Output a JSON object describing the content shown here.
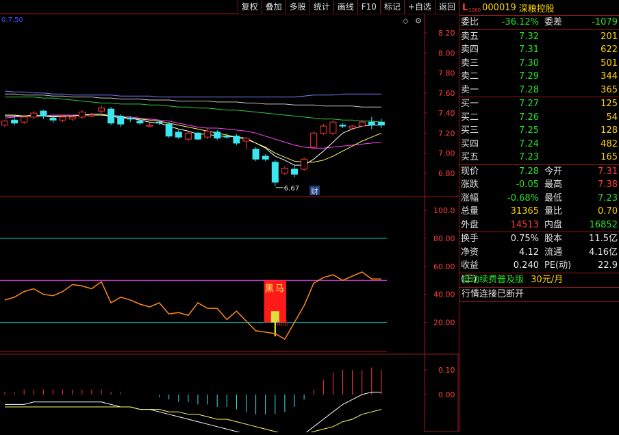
{
  "toolbar": [
    "复权",
    "叠加",
    "多股",
    "统计",
    "画线",
    "F10",
    "标记",
    "+自选",
    "返回"
  ],
  "header": {
    "left_value": "0.7.50",
    "diamond": "◇",
    "settings": "⚙"
  },
  "price_axis": [
    "8.20",
    "8.00",
    "7.80",
    "7.60",
    "7.40",
    "7.20",
    "7.00",
    "6.80"
  ],
  "osc_axis": [
    "100.0",
    "80.00",
    "60.00",
    "40.00",
    "20.00"
  ],
  "macd_axis": [
    "0.10",
    "0.00"
  ],
  "annotations": {
    "low_label": "6.67",
    "cai": "财",
    "hei_ma": "黑马",
    "zhu": "出击"
  },
  "candles": [
    [
      7.28,
      7.32,
      7.33,
      7.26
    ],
    [
      7.33,
      7.3,
      7.36,
      7.28
    ],
    [
      7.31,
      7.36,
      7.38,
      7.29
    ],
    [
      7.36,
      7.4,
      7.42,
      7.34
    ],
    [
      7.42,
      7.37,
      7.43,
      7.34
    ],
    [
      7.35,
      7.33,
      7.37,
      7.3
    ],
    [
      7.33,
      7.36,
      7.38,
      7.31
    ],
    [
      7.34,
      7.36,
      7.38,
      7.32
    ],
    [
      7.36,
      7.41,
      7.43,
      7.34
    ],
    [
      7.38,
      7.38,
      7.4,
      7.36
    ],
    [
      7.42,
      7.45,
      7.48,
      7.4
    ],
    [
      7.44,
      7.3,
      7.46,
      7.28
    ],
    [
      7.37,
      7.29,
      7.39,
      7.26
    ],
    [
      7.35,
      7.34,
      7.37,
      7.31
    ],
    [
      7.32,
      7.3,
      7.34,
      7.28
    ],
    [
      7.28,
      7.28,
      7.3,
      7.26
    ],
    [
      7.31,
      7.3,
      7.32,
      7.28
    ],
    [
      7.29,
      7.17,
      7.31,
      7.15
    ],
    [
      7.21,
      7.16,
      7.23,
      7.14
    ],
    [
      7.14,
      7.2,
      7.22,
      7.12
    ],
    [
      7.2,
      7.14,
      7.21,
      7.13
    ],
    [
      7.16,
      7.22,
      7.25,
      7.14
    ],
    [
      7.21,
      7.15,
      7.23,
      7.13
    ],
    [
      7.17,
      7.16,
      7.2,
      7.14
    ],
    [
      7.17,
      7.1,
      7.19,
      7.08
    ],
    [
      7.12,
      7.15,
      7.16,
      7.04
    ],
    [
      7.04,
      6.94,
      7.06,
      6.92
    ],
    [
      6.97,
      6.94,
      6.99,
      6.92
    ],
    [
      6.91,
      6.71,
      6.93,
      6.67
    ],
    [
      6.8,
      6.85,
      6.87,
      6.78
    ],
    [
      6.84,
      6.79,
      6.88,
      6.76
    ],
    [
      6.84,
      6.94,
      6.96,
      6.82
    ],
    [
      7.06,
      7.2,
      7.22,
      7.04
    ],
    [
      7.2,
      7.27,
      7.29,
      7.18
    ],
    [
      7.2,
      7.31,
      7.33,
      7.18
    ],
    [
      7.28,
      7.27,
      7.3,
      7.25
    ],
    [
      7.25,
      7.27,
      7.28,
      7.24
    ],
    [
      7.27,
      7.31,
      7.33,
      7.26
    ],
    [
      7.31,
      7.28,
      7.36,
      7.24
    ],
    [
      7.31,
      7.28,
      7.34,
      7.25
    ]
  ],
  "ma_lines": [
    {
      "color": "#7b7bff",
      "values": [
        7.62,
        7.61,
        7.61,
        7.6,
        7.6,
        7.59,
        7.59,
        7.58,
        7.58,
        7.58,
        7.58,
        7.58,
        7.57,
        7.57,
        7.57,
        7.57,
        7.56,
        7.56,
        7.56,
        7.56,
        7.56,
        7.56,
        7.56,
        7.56,
        7.56,
        7.56,
        7.56,
        7.56,
        7.56,
        7.56,
        7.56,
        7.57,
        7.58,
        7.58,
        7.58,
        7.59,
        7.59,
        7.59,
        7.59,
        7.59
      ]
    },
    {
      "color": "#c8c8c8",
      "values": [
        7.59,
        7.59,
        7.58,
        7.58,
        7.58,
        7.57,
        7.57,
        7.56,
        7.56,
        7.56,
        7.55,
        7.55,
        7.54,
        7.54,
        7.54,
        7.53,
        7.53,
        7.53,
        7.52,
        7.52,
        7.52,
        7.52,
        7.51,
        7.51,
        7.51,
        7.5,
        7.5,
        7.49,
        7.49,
        7.49,
        7.48,
        7.48,
        7.48,
        7.47,
        7.47,
        7.47,
        7.47,
        7.46,
        7.46,
        7.46
      ]
    },
    {
      "color": "#2ecc40",
      "values": [
        7.56,
        7.56,
        7.56,
        7.56,
        7.55,
        7.55,
        7.54,
        7.53,
        7.52,
        7.51,
        7.5,
        7.5,
        7.49,
        7.49,
        7.49,
        7.48,
        7.48,
        7.47,
        7.46,
        7.46,
        7.45,
        7.45,
        7.44,
        7.43,
        7.43,
        7.42,
        7.41,
        7.4,
        7.39,
        7.38,
        7.37,
        7.36,
        7.35,
        7.34,
        7.34,
        7.33,
        7.33,
        7.32,
        7.32,
        7.31
      ]
    },
    {
      "color": "#ff44ff",
      "values": [
        7.35,
        7.36,
        7.37,
        7.37,
        7.37,
        7.38,
        7.38,
        7.38,
        7.38,
        7.38,
        7.38,
        7.38,
        7.37,
        7.36,
        7.35,
        7.34,
        7.33,
        7.32,
        7.3,
        7.28,
        7.26,
        7.25,
        7.25,
        7.24,
        7.23,
        7.22,
        7.2,
        7.17,
        7.14,
        7.11,
        7.08,
        7.06,
        7.05,
        7.05,
        7.06,
        7.07,
        7.08,
        7.09,
        7.1,
        7.11
      ]
    },
    {
      "color": "#ffffff",
      "values": [
        7.37,
        7.37,
        7.37,
        7.38,
        7.37,
        7.36,
        7.37,
        7.37,
        7.38,
        7.39,
        7.39,
        7.37,
        7.35,
        7.35,
        7.33,
        7.31,
        7.3,
        7.27,
        7.24,
        7.22,
        7.19,
        7.19,
        7.17,
        7.17,
        7.16,
        7.15,
        7.1,
        7.05,
        6.97,
        6.93,
        6.88,
        6.88,
        6.94,
        7.02,
        7.11,
        7.2,
        7.24,
        7.27,
        7.28,
        7.28
      ]
    },
    {
      "color": "#ffff66",
      "values": [
        7.38,
        7.38,
        7.37,
        7.37,
        7.37,
        7.37,
        7.37,
        7.37,
        7.38,
        7.38,
        7.38,
        7.37,
        7.36,
        7.35,
        7.34,
        7.33,
        7.32,
        7.3,
        7.28,
        7.26,
        7.24,
        7.22,
        7.2,
        7.18,
        7.16,
        7.14,
        7.1,
        7.06,
        7.0,
        6.96,
        6.92,
        6.91,
        6.91,
        6.93,
        6.97,
        7.02,
        7.07,
        7.12,
        7.16,
        7.2
      ]
    }
  ],
  "osc_values": [
    36,
    38,
    42,
    44,
    40,
    39,
    42,
    47,
    46,
    44,
    49,
    34,
    38,
    36,
    33,
    31,
    34,
    26,
    27,
    25,
    34,
    30,
    30,
    22,
    28,
    21,
    14,
    13,
    12,
    8,
    20,
    32,
    48,
    52,
    54,
    50,
    53,
    56,
    51,
    51
  ],
  "macd": {
    "bars": [
      0.01,
      0.01,
      0.02,
      0.02,
      0.02,
      0.02,
      0.02,
      0.02,
      0.02,
      0.02,
      0.02,
      0.01,
      0.01,
      0.0,
      0.0,
      0.0,
      -0.01,
      -0.02,
      -0.03,
      -0.03,
      -0.04,
      -0.04,
      -0.05,
      -0.05,
      -0.06,
      -0.07,
      -0.08,
      -0.08,
      -0.08,
      -0.07,
      -0.05,
      -0.02,
      0.02,
      0.06,
      0.09,
      0.1,
      0.1,
      0.1,
      0.11,
      0.1
    ],
    "dif": [
      -0.04,
      -0.04,
      -0.04,
      -0.03,
      -0.03,
      -0.03,
      -0.03,
      -0.03,
      -0.03,
      -0.03,
      -0.03,
      -0.04,
      -0.05,
      -0.05,
      -0.06,
      -0.06,
      -0.07,
      -0.08,
      -0.09,
      -0.1,
      -0.11,
      -0.12,
      -0.13,
      -0.14,
      -0.15,
      -0.16,
      -0.17,
      -0.18,
      -0.19,
      -0.19,
      -0.18,
      -0.16,
      -0.13,
      -0.1,
      -0.07,
      -0.04,
      -0.02,
      0.0,
      0.01,
      0.01
    ],
    "dea": [
      -0.05,
      -0.05,
      -0.05,
      -0.05,
      -0.05,
      -0.05,
      -0.05,
      -0.05,
      -0.05,
      -0.05,
      -0.05,
      -0.05,
      -0.05,
      -0.05,
      -0.06,
      -0.06,
      -0.06,
      -0.07,
      -0.07,
      -0.08,
      -0.08,
      -0.09,
      -0.1,
      -0.1,
      -0.11,
      -0.12,
      -0.13,
      -0.14,
      -0.15,
      -0.16,
      -0.16,
      -0.16,
      -0.15,
      -0.14,
      -0.13,
      -0.11,
      -0.1,
      -0.08,
      -0.07,
      -0.06
    ]
  },
  "panel": {
    "L": "L",
    "sub": "1000",
    "code": "000019",
    "name": "深粮控股",
    "weibi": {
      "l1": "委比",
      "v1": "-36.12%",
      "l2": "委差",
      "v2": "-1079"
    },
    "sells": [
      {
        "l": "卖五",
        "p": "7.32",
        "v": "201"
      },
      {
        "l": "卖四",
        "p": "7.31",
        "v": "622"
      },
      {
        "l": "卖三",
        "p": "7.30",
        "v": "501"
      },
      {
        "l": "卖二",
        "p": "7.29",
        "v": "344"
      },
      {
        "l": "卖一",
        "p": "7.28",
        "v": "365"
      }
    ],
    "buys": [
      {
        "l": "买一",
        "p": "7.27",
        "v": "125"
      },
      {
        "l": "买二",
        "p": "7.26",
        "v": "54"
      },
      {
        "l": "买三",
        "p": "7.25",
        "v": "128"
      },
      {
        "l": "买四",
        "p": "7.24",
        "v": "482"
      },
      {
        "l": "买五",
        "p": "7.23",
        "v": "165"
      }
    ],
    "q": [
      {
        "l1": "现价",
        "v1": "7.28",
        "l2": "今开",
        "v2": "7.31"
      },
      {
        "l1": "涨跌",
        "v1": "-0.05",
        "l2": "最高",
        "v2": "7.38"
      },
      {
        "l1": "涨幅",
        "v1": "-0.68%",
        "l2": "最低",
        "v2": "7.23"
      },
      {
        "l1": "总量",
        "v1": "31365",
        "l2": "量比",
        "v2": "0.70"
      },
      {
        "l1": "外盘",
        "v1": "14513",
        "l2": "内盘",
        "v2": "16852"
      }
    ],
    "f": [
      {
        "l1": "换手",
        "v1": "0.75%",
        "l2": "股本",
        "v2": "11.5亿"
      },
      {
        "l1": "净资",
        "v1": "4.12",
        "l2": "流通",
        "v2": "4.16亿"
      },
      {
        "l1": "收益(三)",
        "v1": "0.240",
        "l2": "PE(动)",
        "v2": "22.9"
      }
    ],
    "promo_text": "自动续费普及版",
    "promo_price": "30元/月",
    "status": "行情连接已断开"
  }
}
